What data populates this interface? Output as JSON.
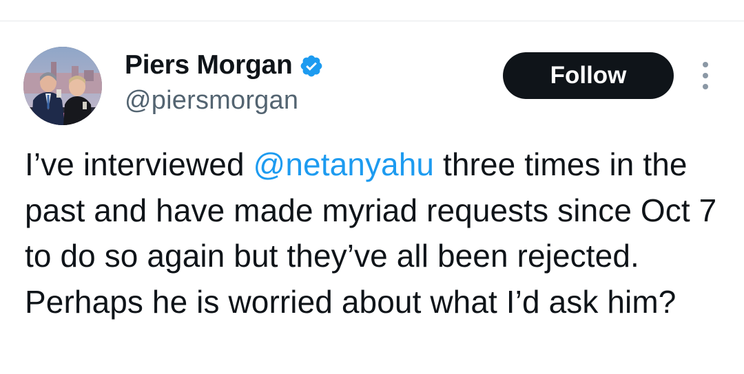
{
  "author": {
    "display_name": "Piers Morgan",
    "handle": "@piersmorgan",
    "verified": true,
    "avatar_icon": "profile-photo"
  },
  "actions": {
    "follow_label": "Follow",
    "more_icon": "more-vertical-icon"
  },
  "tweet": {
    "text_before_mention": "I’ve interviewed ",
    "mention": "@netanyahu",
    "text_after_mention": " three times in the past and have made myriad requests since Oct 7 to do so again but they’ve all been rejected. Perhaps he is worried about what I’d ask him?"
  },
  "colors": {
    "accent": "#1d9bf0",
    "text_primary": "#0f1419",
    "text_secondary": "#536471",
    "button_bg": "#0f1419"
  }
}
